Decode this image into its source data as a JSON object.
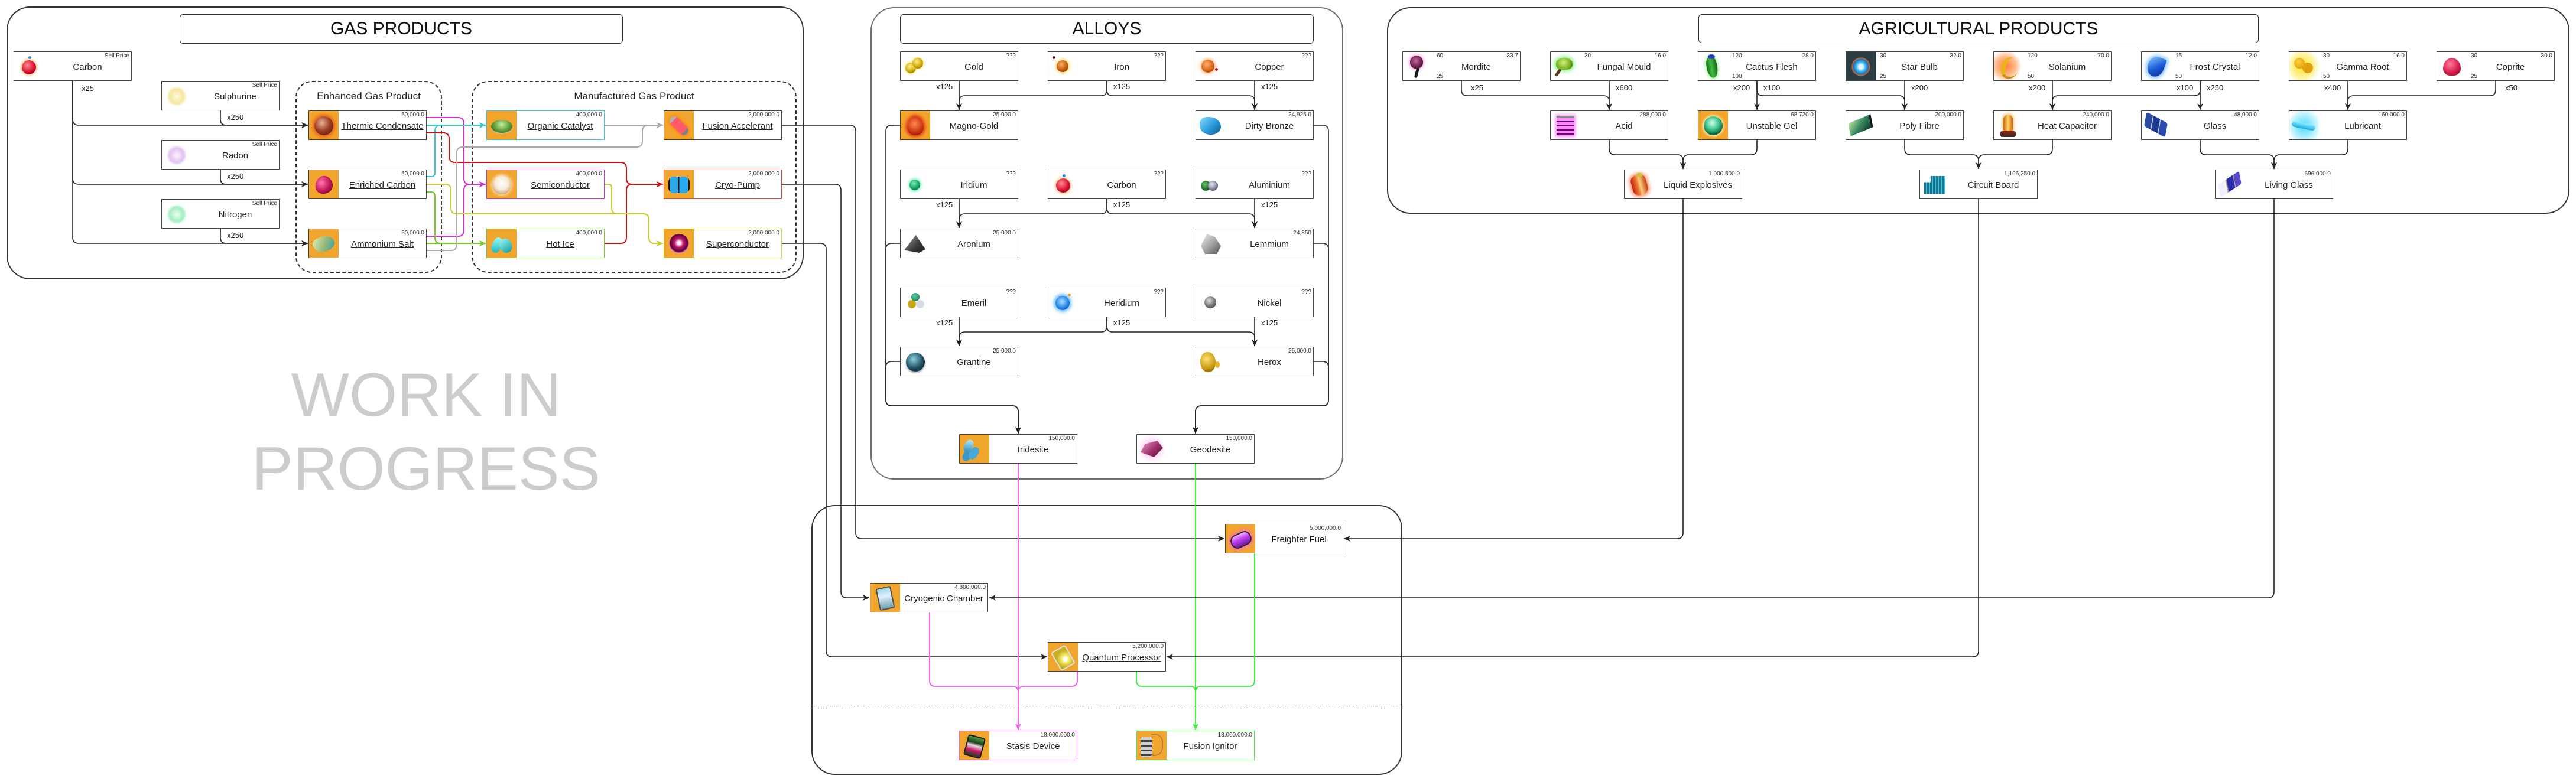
{
  "sections": {
    "gas_products": {
      "title": "GAS PRODUCTS",
      "enhanced_group": "Enhanced Gas Product",
      "manufactured_group": "Manufactured Gas Product"
    },
    "alloys": {
      "title": "ALLOYS"
    },
    "agricultural_products": {
      "title": "AGRICULTURAL PRODUCTS"
    }
  },
  "watermark": {
    "line1": "WORK IN",
    "line2": "PROGRESS"
  },
  "colors": {
    "icon_bg": "#f2a52c",
    "cyan": "#33cccc",
    "magenta": "#cc33cc",
    "red": "#cc1111",
    "gray": "#aaaaaa",
    "yellow": "#cccc33",
    "lime": "#77cc22",
    "pink": "#ee66ee",
    "green": "#44ee44",
    "watermark": "#cccccc"
  },
  "nodes": {
    "gas_carbon": {
      "name": "Carbon",
      "value": "Sell Price",
      "icon": "carbon-icon"
    },
    "sulphurine": {
      "name": "Sulphurine",
      "value": "Sell Price",
      "icon": "sulphurine-icon"
    },
    "radon": {
      "name": "Radon",
      "value": "Sell Price",
      "icon": "radon-icon"
    },
    "nitrogen": {
      "name": "Nitrogen",
      "value": "Sell Price",
      "icon": "nitrogen-icon"
    },
    "thermic_condensate": {
      "name": "Thermic Condensate",
      "value": "50,000.0",
      "icon": "thermic-condensate-icon",
      "linked": true
    },
    "enriched_carbon": {
      "name": "Enriched Carbon",
      "value": "50,000.0",
      "icon": "enriched-carbon-icon",
      "linked": true
    },
    "ammonium_salt": {
      "name": "Ammonium Salt",
      "value": "50,000.0",
      "icon": "ammonium-salt-icon",
      "linked": true
    },
    "organic_catalyst": {
      "name": "Organic Catalyst",
      "value": "400,000.0",
      "icon": "organic-catalyst-icon",
      "linked": true
    },
    "semiconductor": {
      "name": "Semiconductor",
      "value": "400,000.0",
      "icon": "semiconductor-icon",
      "linked": true
    },
    "hot_ice": {
      "name": "Hot Ice",
      "value": "400,000.0",
      "icon": "hot-ice-icon",
      "linked": true
    },
    "fusion_accelerant": {
      "name": "Fusion Accelerant",
      "value": "2,000,000.0",
      "icon": "fusion-accelerant-icon",
      "linked": true
    },
    "cryo_pump": {
      "name": "Cryo-Pump",
      "value": "2,000,000.0",
      "icon": "cryo-pump-icon",
      "linked": true
    },
    "superconductor": {
      "name": "Superconductor",
      "value": "2,000,000.0",
      "icon": "superconductor-icon",
      "linked": true
    },
    "gold": {
      "name": "Gold",
      "value": "???",
      "icon": "gold-icon"
    },
    "iron": {
      "name": "Iron",
      "value": "???",
      "icon": "iron-icon"
    },
    "copper": {
      "name": "Copper",
      "value": "???",
      "icon": "copper-icon"
    },
    "magno_gold": {
      "name": "Magno-Gold",
      "value": "25,000.0",
      "icon": "magno-gold-icon"
    },
    "dirty_bronze": {
      "name": "Dirty Bronze",
      "value": "24,925.0",
      "icon": "dirty-bronze-icon"
    },
    "iridium": {
      "name": "Iridium",
      "value": "???",
      "icon": "iridium-icon"
    },
    "alloy_carbon": {
      "name": "Carbon",
      "value": "???",
      "icon": "carbon-icon"
    },
    "aluminium": {
      "name": "Aluminium",
      "value": "???",
      "icon": "aluminium-icon"
    },
    "aronium": {
      "name": "Aronium",
      "value": "25,000.0",
      "icon": "aronium-icon"
    },
    "lemmium": {
      "name": "Lemmium",
      "value": "24,850",
      "icon": "lemmium-icon"
    },
    "emeril": {
      "name": "Emeril",
      "value": "???",
      "icon": "emeril-icon"
    },
    "heridium": {
      "name": "Heridium",
      "value": "???",
      "icon": "heridium-icon"
    },
    "nickel": {
      "name": "Nickel",
      "value": "???",
      "icon": "nickel-icon"
    },
    "grantine": {
      "name": "Grantine",
      "value": "25,000.0",
      "icon": "grantine-icon"
    },
    "herox": {
      "name": "Herox",
      "value": "25,000.0",
      "icon": "herox-icon"
    },
    "iridesite": {
      "name": "Iridesite",
      "value": "150,000.0",
      "icon": "iridesite-icon"
    },
    "geodesite": {
      "name": "Geodesite",
      "value": "150,000.0",
      "icon": "geodesite-icon"
    },
    "mordite": {
      "name": "Mordite",
      "value": "33.7",
      "stat_top": "60",
      "stat_bottom": "25",
      "icon": "mordite-icon"
    },
    "fungal_mould": {
      "name": "Fungal Mould",
      "value": "16.0",
      "stat_top": "30",
      "icon": "fungal-mould-icon"
    },
    "cactus_flesh": {
      "name": "Cactus Flesh",
      "value": "28.0",
      "stat_top": "120",
      "stat_bottom": "100",
      "icon": "cactus-flesh-icon"
    },
    "star_bulb": {
      "name": "Star Bulb",
      "value": "32.0",
      "stat_top": "30",
      "stat_bottom": "25",
      "icon": "star-bulb-icon"
    },
    "solanium": {
      "name": "Solanium",
      "value": "70.0",
      "stat_top": "120",
      "stat_bottom": "50",
      "icon": "solanium-icon"
    },
    "frost_crystal": {
      "name": "Frost Crystal",
      "value": "12.0",
      "stat_top": "15",
      "stat_bottom": "50",
      "icon": "frost-crystal-icon"
    },
    "gamma_root": {
      "name": "Gamma Root",
      "value": "16.0",
      "stat_top": "30",
      "stat_bottom": "50",
      "icon": "gamma-root-icon"
    },
    "coprite": {
      "name": "Coprite",
      "value": "30.0",
      "stat_top": "30",
      "stat_bottom": "25",
      "icon": "coprite-icon"
    },
    "acid": {
      "name": "Acid",
      "value": "288,000.0",
      "icon": "acid-icon"
    },
    "unstable_gel": {
      "name": "Unstable Gel",
      "value": "68,720.0",
      "icon": "unstable-gel-icon"
    },
    "poly_fibre": {
      "name": "Poly Fibre",
      "value": "200,000.0",
      "icon": "poly-fibre-icon"
    },
    "heat_capacitor": {
      "name": "Heat Capacitor",
      "value": "240,000.0",
      "icon": "heat-capacitor-icon"
    },
    "glass": {
      "name": "Glass",
      "value": "48,000.0",
      "icon": "glass-icon"
    },
    "lubricant": {
      "name": "Lubricant",
      "value": "160,000.0",
      "icon": "lubricant-icon"
    },
    "liquid_explosives": {
      "name": "Liquid Explosives",
      "value": "1,000,500.0",
      "icon": "liquid-explosives-icon"
    },
    "circuit_board": {
      "name": "Circuit Board",
      "value": "1,196,250.0",
      "icon": "circuit-board-icon"
    },
    "living_glass": {
      "name": "Living Glass",
      "value": "696,000.0",
      "icon": "living-glass-icon"
    },
    "freighter_fuel": {
      "name": "Freighter Fuel",
      "value": "5,000,000.0",
      "icon": "freighter-fuel-icon",
      "linked": true
    },
    "cryogenic_chamber": {
      "name": "Cryogenic Chamber",
      "value": "4,800,000.0",
      "icon": "cryogenic-chamber-icon",
      "linked": true
    },
    "quantum_processor": {
      "name": "Quantum Processor",
      "value": "5,200,000.0",
      "icon": "quantum-processor-icon",
      "linked": true
    },
    "stasis_device": {
      "name": "Stasis Device",
      "value": "18,000,000.0",
      "icon": "stasis-device-icon"
    },
    "fusion_ignitor": {
      "name": "Fusion Ignitor",
      "value": "18,000,000.0",
      "icon": "fusion-ignitor-icon"
    }
  },
  "recipes": {
    "thermic_condensate": {
      "inputs": [
        {
          "item": "Carbon",
          "qty": "x25"
        },
        {
          "item": "Sulphurine",
          "qty": "x250"
        }
      ]
    },
    "enriched_carbon": {
      "inputs": [
        {
          "item": "Carbon",
          "qty": "x25"
        },
        {
          "item": "Radon",
          "qty": "x250"
        }
      ]
    },
    "ammonium_salt": {
      "inputs": [
        {
          "item": "Carbon",
          "qty": "x25"
        },
        {
          "item": "Nitrogen",
          "qty": "x250"
        }
      ]
    },
    "organic_catalyst": {
      "inputs": [
        {
          "item": "Thermic Condensate"
        },
        {
          "item": "Enriched Carbon"
        }
      ]
    },
    "semiconductor": {
      "inputs": [
        {
          "item": "Thermic Condensate"
        },
        {
          "item": "Ammonium Salt"
        }
      ]
    },
    "hot_ice": {
      "inputs": [
        {
          "item": "Enriched Carbon"
        },
        {
          "item": "Ammonium Salt"
        }
      ]
    },
    "fusion_accelerant": {
      "inputs": [
        {
          "item": "Organic Catalyst"
        },
        {
          "item": "Ammonium Salt"
        }
      ]
    },
    "cryo_pump": {
      "inputs": [
        {
          "item": "Thermic Condensate"
        },
        {
          "item": "Hot Ice"
        }
      ]
    },
    "superconductor": {
      "inputs": [
        {
          "item": "Enriched Carbon"
        },
        {
          "item": "Semiconductor"
        }
      ]
    },
    "magno_gold": {
      "inputs": [
        {
          "item": "Gold",
          "qty": "x125"
        },
        {
          "item": "Iron",
          "qty": "x125"
        }
      ]
    },
    "dirty_bronze": {
      "inputs": [
        {
          "item": "Iron",
          "qty": "x125"
        },
        {
          "item": "Copper",
          "qty": "x125"
        }
      ]
    },
    "aronium": {
      "inputs": [
        {
          "item": "Iridium",
          "qty": "x125"
        },
        {
          "item": "Carbon",
          "qty": "x125"
        }
      ]
    },
    "lemmium": {
      "inputs": [
        {
          "item": "Carbon",
          "qty": "x125"
        },
        {
          "item": "Aluminium",
          "qty": "x125"
        }
      ]
    },
    "grantine": {
      "inputs": [
        {
          "item": "Emeril",
          "qty": "x125"
        },
        {
          "item": "Heridium",
          "qty": "x125"
        }
      ]
    },
    "herox": {
      "inputs": [
        {
          "item": "Heridium",
          "qty": "x125"
        },
        {
          "item": "Nickel",
          "qty": "x125"
        }
      ]
    },
    "iridesite": {
      "inputs": [
        {
          "item": "Magno-Gold"
        },
        {
          "item": "Aronium"
        },
        {
          "item": "Grantine"
        }
      ]
    },
    "geodesite": {
      "inputs": [
        {
          "item": "Dirty Bronze"
        },
        {
          "item": "Lemmium"
        },
        {
          "item": "Herox"
        }
      ]
    },
    "acid": {
      "inputs": [
        {
          "item": "Mordite",
          "qty": "x25"
        },
        {
          "item": "Fungal Mould",
          "qty": "x600"
        }
      ]
    },
    "unstable_gel": {
      "inputs": [
        {
          "item": "Cactus Flesh",
          "qty": "x200"
        }
      ]
    },
    "poly_fibre": {
      "inputs": [
        {
          "item": "Cactus Flesh",
          "qty": "x100"
        },
        {
          "item": "Star Bulb",
          "qty": "x200"
        }
      ]
    },
    "heat_capacitor": {
      "inputs": [
        {
          "item": "Solanium",
          "qty": "x200"
        },
        {
          "item": "Frost Crystal",
          "qty": "x100"
        }
      ]
    },
    "glass": {
      "inputs": [
        {
          "item": "Frost Crystal",
          "qty": "x250"
        }
      ]
    },
    "lubricant": {
      "inputs": [
        {
          "item": "Gamma Root",
          "qty": "x400"
        },
        {
          "item": "Coprite",
          "qty": "x50"
        }
      ]
    },
    "liquid_explosives": {
      "inputs": [
        {
          "item": "Acid"
        },
        {
          "item": "Unstable Gel"
        }
      ]
    },
    "circuit_board": {
      "inputs": [
        {
          "item": "Poly Fibre"
        },
        {
          "item": "Heat Capacitor"
        }
      ]
    },
    "living_glass": {
      "inputs": [
        {
          "item": "Glass"
        },
        {
          "item": "Lubricant"
        }
      ]
    },
    "freighter_fuel": {
      "inputs": [
        {
          "item": "Fusion Accelerant"
        },
        {
          "item": "Liquid Explosives"
        }
      ]
    },
    "cryogenic_chamber": {
      "inputs": [
        {
          "item": "Cryo-Pump"
        },
        {
          "item": "Living Glass"
        }
      ]
    },
    "quantum_processor": {
      "inputs": [
        {
          "item": "Superconductor"
        },
        {
          "item": "Circuit Board"
        }
      ]
    },
    "stasis_device": {
      "inputs": [
        {
          "item": "Iridesite"
        },
        {
          "item": "Cryogenic Chamber"
        },
        {
          "item": "Quantum Processor"
        }
      ]
    },
    "fusion_ignitor": {
      "inputs": [
        {
          "item": "Geodesite"
        },
        {
          "item": "Quantum Processor"
        },
        {
          "item": "Freighter Fuel"
        }
      ]
    }
  }
}
